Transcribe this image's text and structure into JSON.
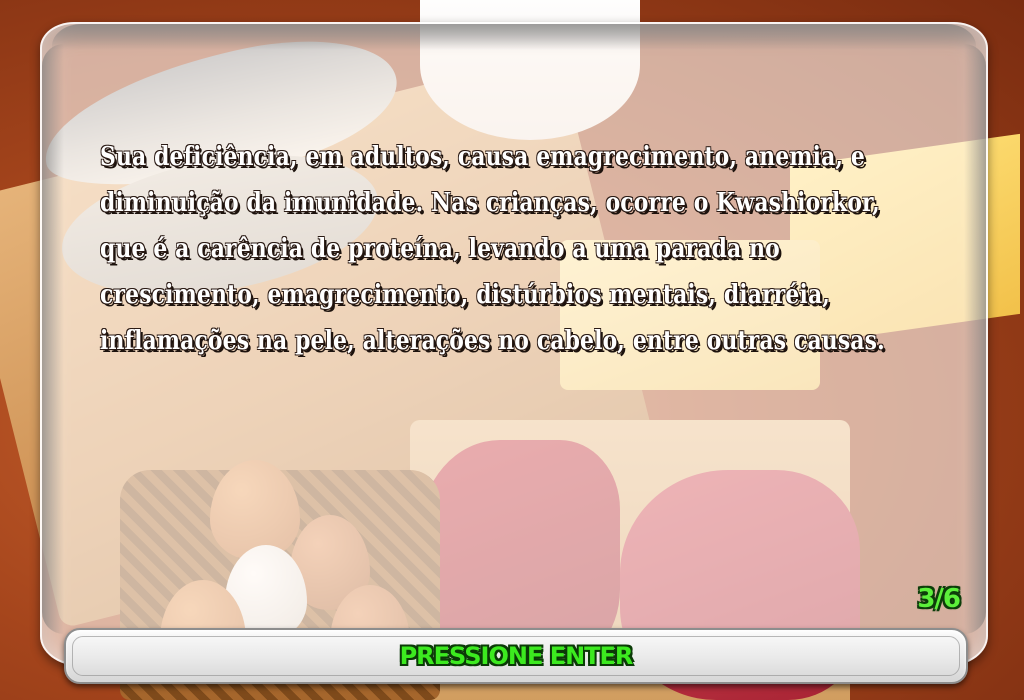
{
  "dialog": {
    "lines": [
      "Sua deficiência, em adultos, causa emagrecimento, anemia, e",
      "diminuição da imunidade. Nas crianças, ocorre o Kwashiorkor,",
      "que é a carência de proteína, levando a uma parada no",
      "crescimento, emagrecimento, distúrbios mentais, diarréia,",
      "inflamações na pele, alterações no cabelo, entre outras causas."
    ]
  },
  "pager": {
    "counter": "3/6",
    "current": 3,
    "total": 6
  },
  "prompt": {
    "label": "PRESSIONE ENTER"
  },
  "colors": {
    "accent_green": "#3cea1f",
    "text": "#ffffff"
  }
}
